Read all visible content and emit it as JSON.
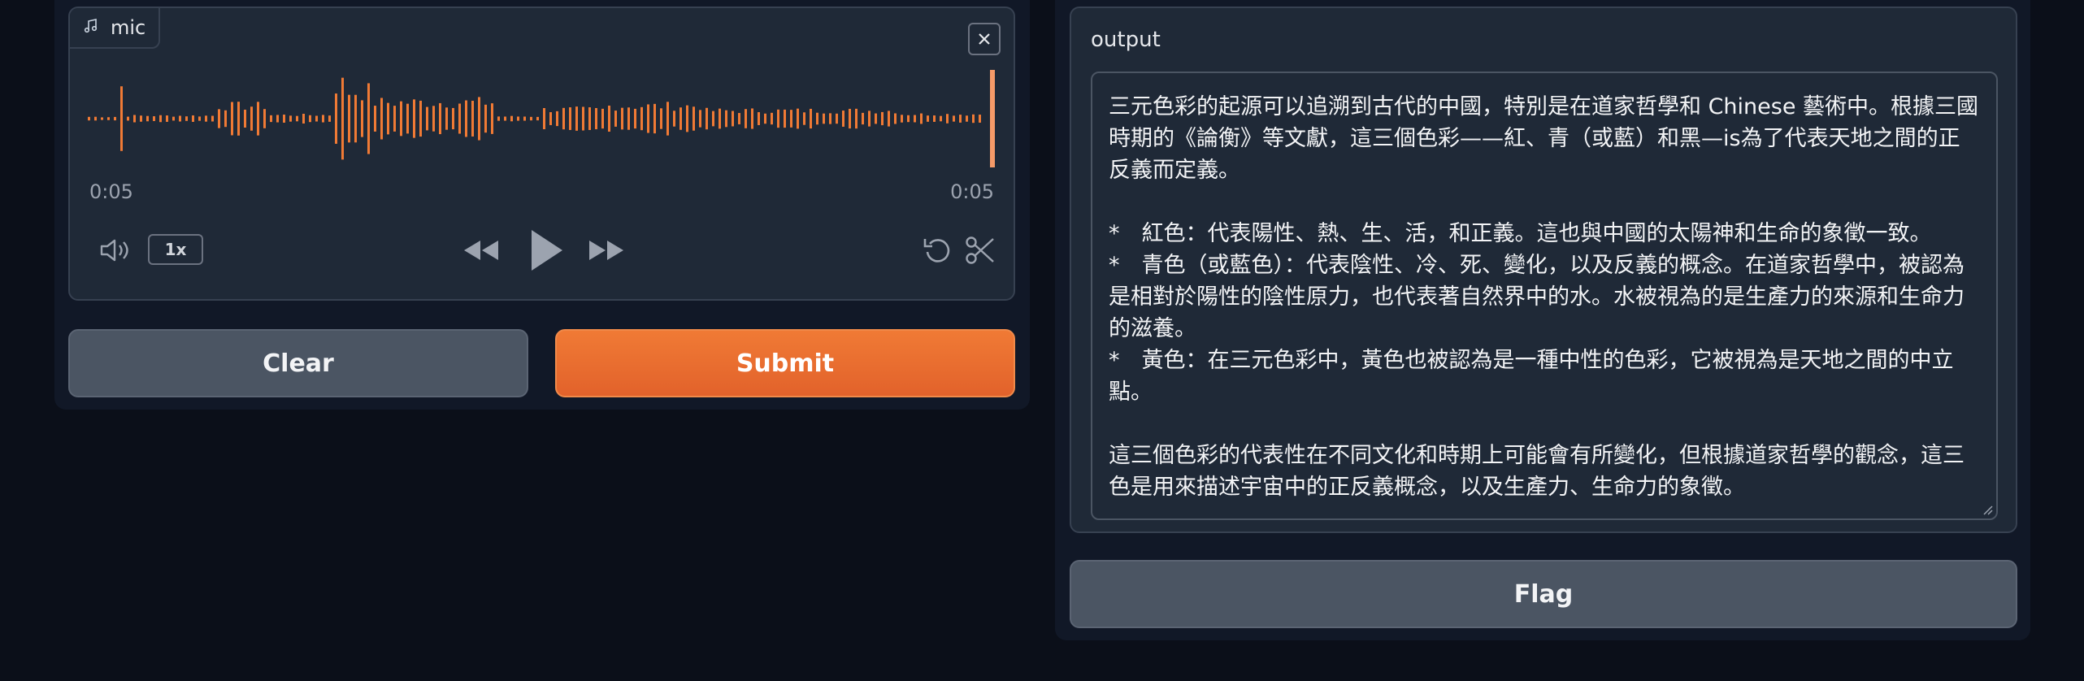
{
  "audio": {
    "source_label": "mic",
    "current_time": "0:05",
    "duration": "0:05",
    "playback_speed": "1x"
  },
  "actions": {
    "clear_label": "Clear",
    "submit_label": "Submit",
    "flag_label": "Flag"
  },
  "output": {
    "label": "output",
    "text": "三元色彩的起源可以追溯到古代的中國，特別是在道家哲學和 Chinese 藝術中。根據三國時期的《論衡》等文獻，這三個色彩——紅、青（或藍）和黑—is為了代表天地之間的正反義而定義。\n\n*　紅色：代表陽性、熱、生、活，和正義。這也與中國的太陽神和生命的象徵一致。\n*　青色（或藍色）：代表陰性、冷、死、變化，以及反義的概念。在道家哲學中，被認為是相對於陽性的陰性原力，也代表著自然界中的水。水被視為的是生產力的來源和生命力的滋養。\n*　黃色：在三元色彩中，黃色也被認為是一種中性的色彩，它被視為是天地之間的中立點。\n\n這三個色彩的代表性在不同文化和時期上可能會有所變化，但根據道家哲學的觀念，這三色是用來描述宇宙中的正反義概念，以及生產力、生命力的象徵。"
  },
  "colors": {
    "accent": "#f07a35",
    "waveform": "#f07a35",
    "panel": "#1f2937",
    "background": "#0b0f19"
  }
}
